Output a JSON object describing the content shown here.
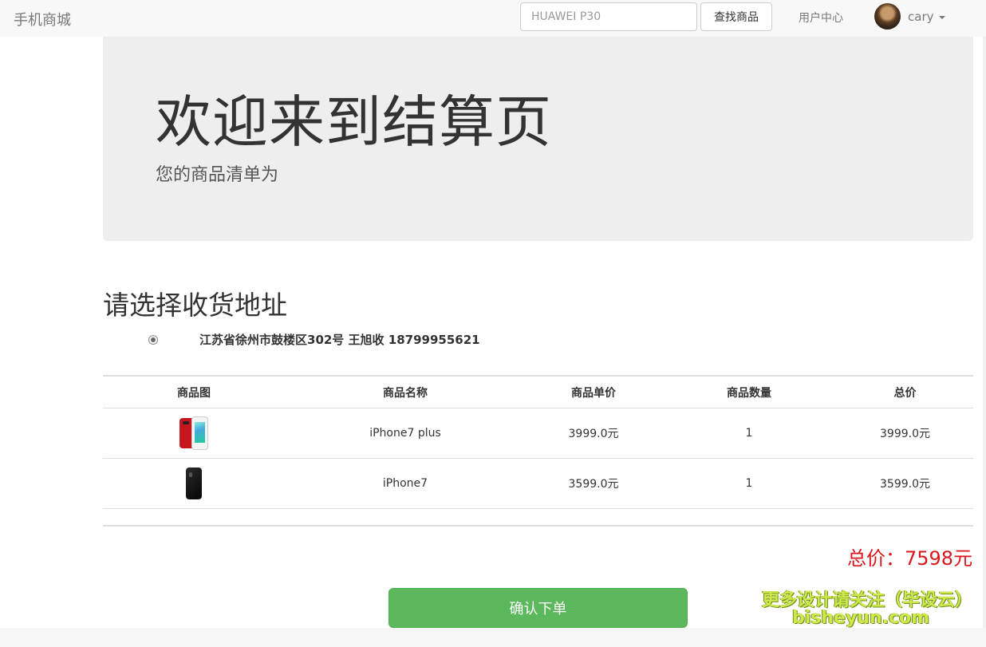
{
  "navbar": {
    "brand": "手机商城",
    "search_placeholder": "HUAWEI P30",
    "search_button": "查找商品",
    "user_center": "用户中心",
    "username": "cary",
    "avatar_icon": "user-avatar",
    "caret_icon": "caret-down-icon"
  },
  "jumbotron": {
    "title": "欢迎来到结算页",
    "subtitle": "您的商品清单为"
  },
  "address": {
    "heading": "请选择收货地址",
    "options": [
      {
        "text": "江苏省徐州市鼓楼区302号 王旭收 18799955621",
        "selected": true
      }
    ]
  },
  "cart": {
    "columns": [
      "商品图",
      "商品名称",
      "商品单价",
      "商品数量",
      "总价"
    ],
    "rows": [
      {
        "image_icon": "iphone7plus-red-image",
        "name": "iPhone7 plus",
        "price": "3999.0元",
        "qty": "1",
        "total": "3999.0元"
      },
      {
        "image_icon": "iphone7-black-image",
        "name": "iPhone7",
        "price": "3599.0元",
        "qty": "1",
        "total": "3599.0元"
      }
    ]
  },
  "summary": {
    "total": "总价：7598元"
  },
  "actions": {
    "confirm": "确认下单"
  },
  "watermark": {
    "line1": "更多设计请关注（毕设云）",
    "line2": "bisheyun.com"
  },
  "colors": {
    "navbar_bg": "#f8f8f8",
    "jumbotron_bg": "#eeeeee",
    "confirm_bg": "#5cb85c",
    "total_red": "#d9161c",
    "watermark": "#cfe94d"
  }
}
